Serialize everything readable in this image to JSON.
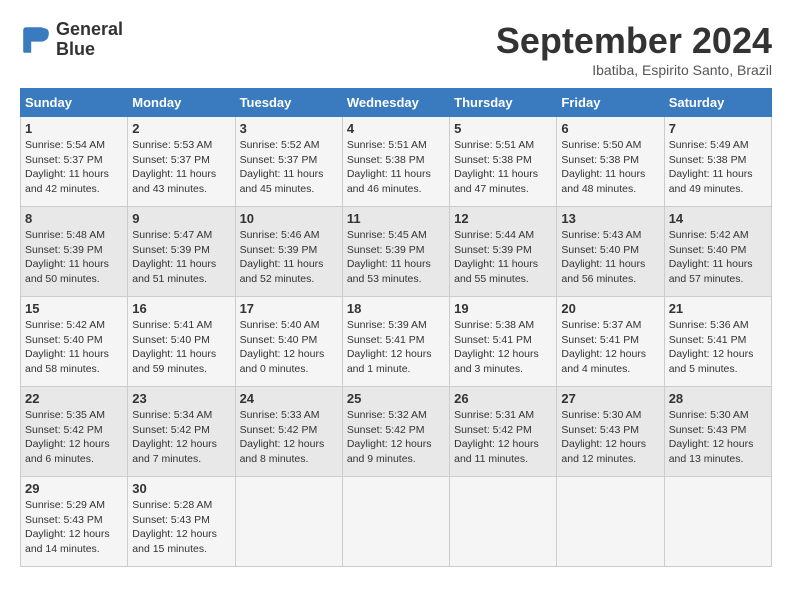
{
  "header": {
    "logo_line1": "General",
    "logo_line2": "Blue",
    "month": "September 2024",
    "location": "Ibatiba, Espirito Santo, Brazil"
  },
  "weekdays": [
    "Sunday",
    "Monday",
    "Tuesday",
    "Wednesday",
    "Thursday",
    "Friday",
    "Saturday"
  ],
  "weeks": [
    [
      {
        "day": "1",
        "sunrise": "5:54 AM",
        "sunset": "5:37 PM",
        "daylight": "11 hours and 42 minutes."
      },
      {
        "day": "2",
        "sunrise": "5:53 AM",
        "sunset": "5:37 PM",
        "daylight": "11 hours and 43 minutes."
      },
      {
        "day": "3",
        "sunrise": "5:52 AM",
        "sunset": "5:37 PM",
        "daylight": "11 hours and 45 minutes."
      },
      {
        "day": "4",
        "sunrise": "5:51 AM",
        "sunset": "5:38 PM",
        "daylight": "11 hours and 46 minutes."
      },
      {
        "day": "5",
        "sunrise": "5:51 AM",
        "sunset": "5:38 PM",
        "daylight": "11 hours and 47 minutes."
      },
      {
        "day": "6",
        "sunrise": "5:50 AM",
        "sunset": "5:38 PM",
        "daylight": "11 hours and 48 minutes."
      },
      {
        "day": "7",
        "sunrise": "5:49 AM",
        "sunset": "5:38 PM",
        "daylight": "11 hours and 49 minutes."
      }
    ],
    [
      {
        "day": "8",
        "sunrise": "5:48 AM",
        "sunset": "5:39 PM",
        "daylight": "11 hours and 50 minutes."
      },
      {
        "day": "9",
        "sunrise": "5:47 AM",
        "sunset": "5:39 PM",
        "daylight": "11 hours and 51 minutes."
      },
      {
        "day": "10",
        "sunrise": "5:46 AM",
        "sunset": "5:39 PM",
        "daylight": "11 hours and 52 minutes."
      },
      {
        "day": "11",
        "sunrise": "5:45 AM",
        "sunset": "5:39 PM",
        "daylight": "11 hours and 53 minutes."
      },
      {
        "day": "12",
        "sunrise": "5:44 AM",
        "sunset": "5:39 PM",
        "daylight": "11 hours and 55 minutes."
      },
      {
        "day": "13",
        "sunrise": "5:43 AM",
        "sunset": "5:40 PM",
        "daylight": "11 hours and 56 minutes."
      },
      {
        "day": "14",
        "sunrise": "5:42 AM",
        "sunset": "5:40 PM",
        "daylight": "11 hours and 57 minutes."
      }
    ],
    [
      {
        "day": "15",
        "sunrise": "5:42 AM",
        "sunset": "5:40 PM",
        "daylight": "11 hours and 58 minutes."
      },
      {
        "day": "16",
        "sunrise": "5:41 AM",
        "sunset": "5:40 PM",
        "daylight": "11 hours and 59 minutes."
      },
      {
        "day": "17",
        "sunrise": "5:40 AM",
        "sunset": "5:40 PM",
        "daylight": "12 hours and 0 minutes."
      },
      {
        "day": "18",
        "sunrise": "5:39 AM",
        "sunset": "5:41 PM",
        "daylight": "12 hours and 1 minute."
      },
      {
        "day": "19",
        "sunrise": "5:38 AM",
        "sunset": "5:41 PM",
        "daylight": "12 hours and 3 minutes."
      },
      {
        "day": "20",
        "sunrise": "5:37 AM",
        "sunset": "5:41 PM",
        "daylight": "12 hours and 4 minutes."
      },
      {
        "day": "21",
        "sunrise": "5:36 AM",
        "sunset": "5:41 PM",
        "daylight": "12 hours and 5 minutes."
      }
    ],
    [
      {
        "day": "22",
        "sunrise": "5:35 AM",
        "sunset": "5:42 PM",
        "daylight": "12 hours and 6 minutes."
      },
      {
        "day": "23",
        "sunrise": "5:34 AM",
        "sunset": "5:42 PM",
        "daylight": "12 hours and 7 minutes."
      },
      {
        "day": "24",
        "sunrise": "5:33 AM",
        "sunset": "5:42 PM",
        "daylight": "12 hours and 8 minutes."
      },
      {
        "day": "25",
        "sunrise": "5:32 AM",
        "sunset": "5:42 PM",
        "daylight": "12 hours and 9 minutes."
      },
      {
        "day": "26",
        "sunrise": "5:31 AM",
        "sunset": "5:42 PM",
        "daylight": "12 hours and 11 minutes."
      },
      {
        "day": "27",
        "sunrise": "5:30 AM",
        "sunset": "5:43 PM",
        "daylight": "12 hours and 12 minutes."
      },
      {
        "day": "28",
        "sunrise": "5:30 AM",
        "sunset": "5:43 PM",
        "daylight": "12 hours and 13 minutes."
      }
    ],
    [
      {
        "day": "29",
        "sunrise": "5:29 AM",
        "sunset": "5:43 PM",
        "daylight": "12 hours and 14 minutes."
      },
      {
        "day": "30",
        "sunrise": "5:28 AM",
        "sunset": "5:43 PM",
        "daylight": "12 hours and 15 minutes."
      },
      null,
      null,
      null,
      null,
      null
    ]
  ]
}
